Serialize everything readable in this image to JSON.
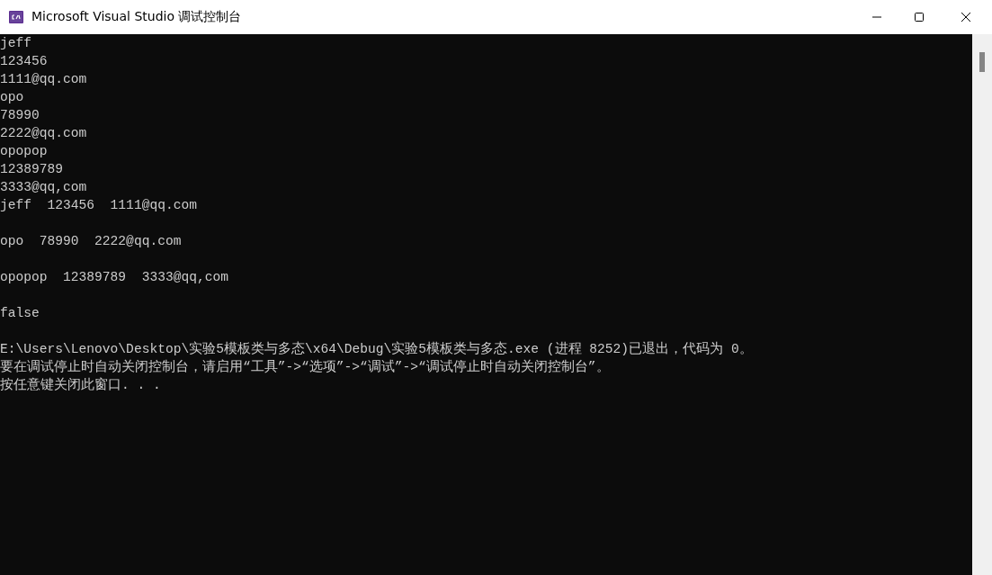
{
  "window": {
    "title": "Microsoft Visual Studio 调试控制台"
  },
  "console": {
    "blocks": [
      {
        "lines": [
          "jeff",
          "123456",
          "1111@qq.com",
          "opo",
          "78990",
          "2222@qq.com",
          "opopop",
          "12389789",
          "3333@qq,com",
          "jeff  123456  1111@qq.com"
        ]
      },
      {
        "lines": [
          "opo  78990  2222@qq.com"
        ]
      },
      {
        "lines": [
          "opopop  12389789  3333@qq,com"
        ]
      },
      {
        "lines": [
          "false"
        ]
      },
      {
        "lines": [
          "E:\\Users\\Lenovo\\Desktop\\实验5模板类与多态\\x64\\Debug\\实验5模板类与多态.exe (进程 8252)已退出，代码为 0。",
          "要在调试停止时自动关闭控制台，请启用“工具”->“选项”->“调试”->“调试停止时自动关闭控制台”。",
          "按任意键关闭此窗口. . ."
        ]
      }
    ]
  }
}
